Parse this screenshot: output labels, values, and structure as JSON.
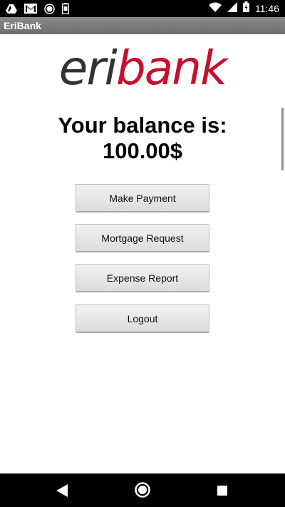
{
  "status_bar": {
    "time": "11:46",
    "left_icons": [
      "drive-icon",
      "gmail-icon",
      "record-icon",
      "battery-saver-icon"
    ],
    "right_icons": [
      "wifi-icon",
      "signal-icon",
      "battery-icon"
    ]
  },
  "app": {
    "title": "EriBank"
  },
  "logo": {
    "part1": "eri",
    "part2": "bank",
    "color_dark": "#333333",
    "color_accent": "#c8102e"
  },
  "balance": {
    "label": "Your balance is:",
    "amount": "100.00$"
  },
  "buttons": {
    "make_payment": "Make Payment",
    "mortgage_request": "Mortgage Request",
    "expense_report": "Expense Report",
    "logout": "Logout"
  },
  "nav_bar": {
    "icons": [
      "back-icon",
      "home-icon",
      "recents-icon"
    ]
  }
}
